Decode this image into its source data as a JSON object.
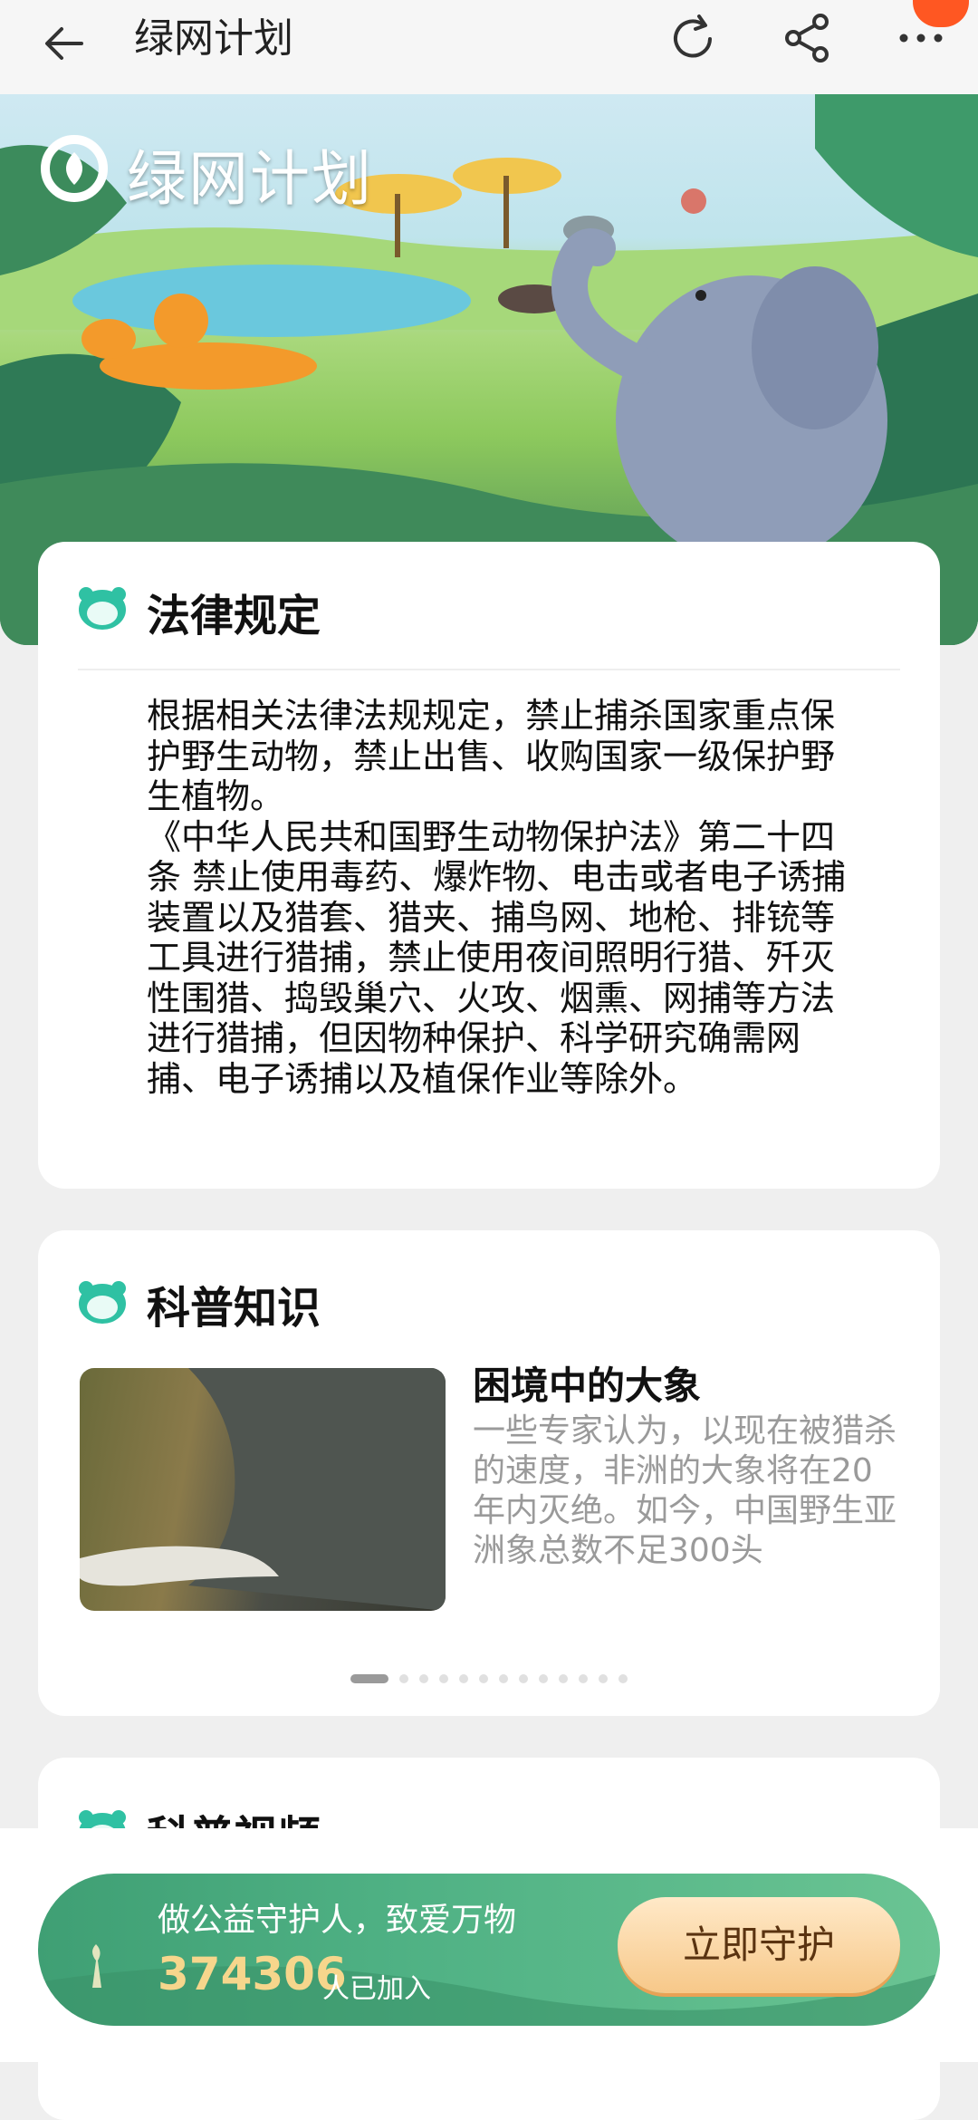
{
  "topbar": {
    "title": "绿网计划",
    "icons": [
      "back-arrow-icon",
      "refresh-icon",
      "share-icon",
      "more-icon"
    ]
  },
  "banner": {
    "logo_text": "绿网计划"
  },
  "law": {
    "title": "法律规定",
    "body": "根据相关法律法规规定，禁止捕杀国家重点保护野生动物，禁止出售、收购国家一级保护野生植物。\n《中华人民共和国野生动物保护法》第二十四条 禁止使用毒药、爆炸物、电击或者电子诱捕装置以及猎套、猎夹、捕鸟网、地枪、排铳等工具进行猎捕，禁止使用夜间照明行猎、歼灭性围猎、捣毁巢穴、火攻、烟熏、网捕等方法进行猎捕，但因物种保护、科学研究确需网捕、电子诱捕以及植保作业等除外。"
  },
  "science": {
    "title": "科普知识",
    "item_title": "困境中的大象",
    "item_desc": "一些专家认为，以现在被猎杀的速度，非洲的大象将在20年内灭绝。如今，中国野生亚洲象总数不足300头",
    "page_count": 13,
    "active_page": 0
  },
  "video": {
    "title": "科普视频"
  },
  "cta": {
    "slogan": "做公益守护人，致爱万物",
    "count": "374306",
    "count_suffix": "人已加入",
    "button_label": "立即守护"
  },
  "colors": {
    "accent_green": "#4fb184",
    "button_gold": "#f7c889",
    "count_gold": "#f6d68c"
  }
}
